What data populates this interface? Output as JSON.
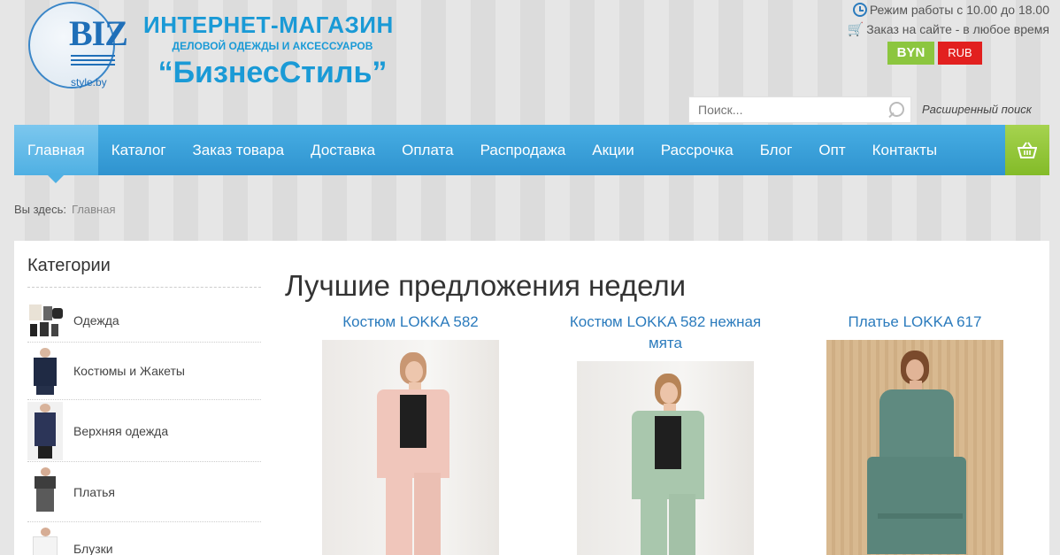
{
  "logo": {
    "mark": "BIZ",
    "sub": "style.by"
  },
  "brand": {
    "title": "ИНТЕРНЕТ-МАГАЗИН",
    "subtitle": "ДЕЛОВОЙ ОДЕЖДЫ И АКСЕССУАРОВ",
    "name": "“БизнесСтиль”"
  },
  "top_info": {
    "hours": "Режим работы с 10.00 до 18.00",
    "order": "Заказ на сайте - в любое время"
  },
  "currency": {
    "byn": "BYN",
    "rub": "RUB"
  },
  "search": {
    "placeholder": "Поиск...",
    "advanced": "Расширенный поиск"
  },
  "nav": {
    "items": [
      "Главная",
      "Каталог",
      "Заказ товара",
      "Доставка",
      "Оплата",
      "Распродажа",
      "Акции",
      "Рассрочка",
      "Блог",
      "Опт",
      "Контакты"
    ],
    "active": "Главная"
  },
  "breadcrumb": {
    "prefix": "Вы здесь:",
    "current": "Главная"
  },
  "categories": {
    "title": "Категории",
    "items": [
      "Одежда",
      "Костюмы и Жакеты",
      "Верхняя одежда",
      "Платья",
      "Блузки"
    ]
  },
  "featured": {
    "title": "Лучшие предложения недели",
    "products": [
      {
        "name": "Костюм LOKKA 582",
        "garment_color": "#f0c6bb"
      },
      {
        "name": "Костюм LOKKA 582 нежная мята",
        "garment_color": "#a9c7ad"
      },
      {
        "name": "Платье LOKKA 617",
        "garment_color": "#5f8a80"
      }
    ]
  },
  "colors": {
    "brand_blue": "#1a9ad6",
    "nav_blue": "#3aa0da",
    "byn_green": "#8cc63f",
    "rub_red": "#e2201f",
    "link_blue": "#2b7bbd"
  }
}
